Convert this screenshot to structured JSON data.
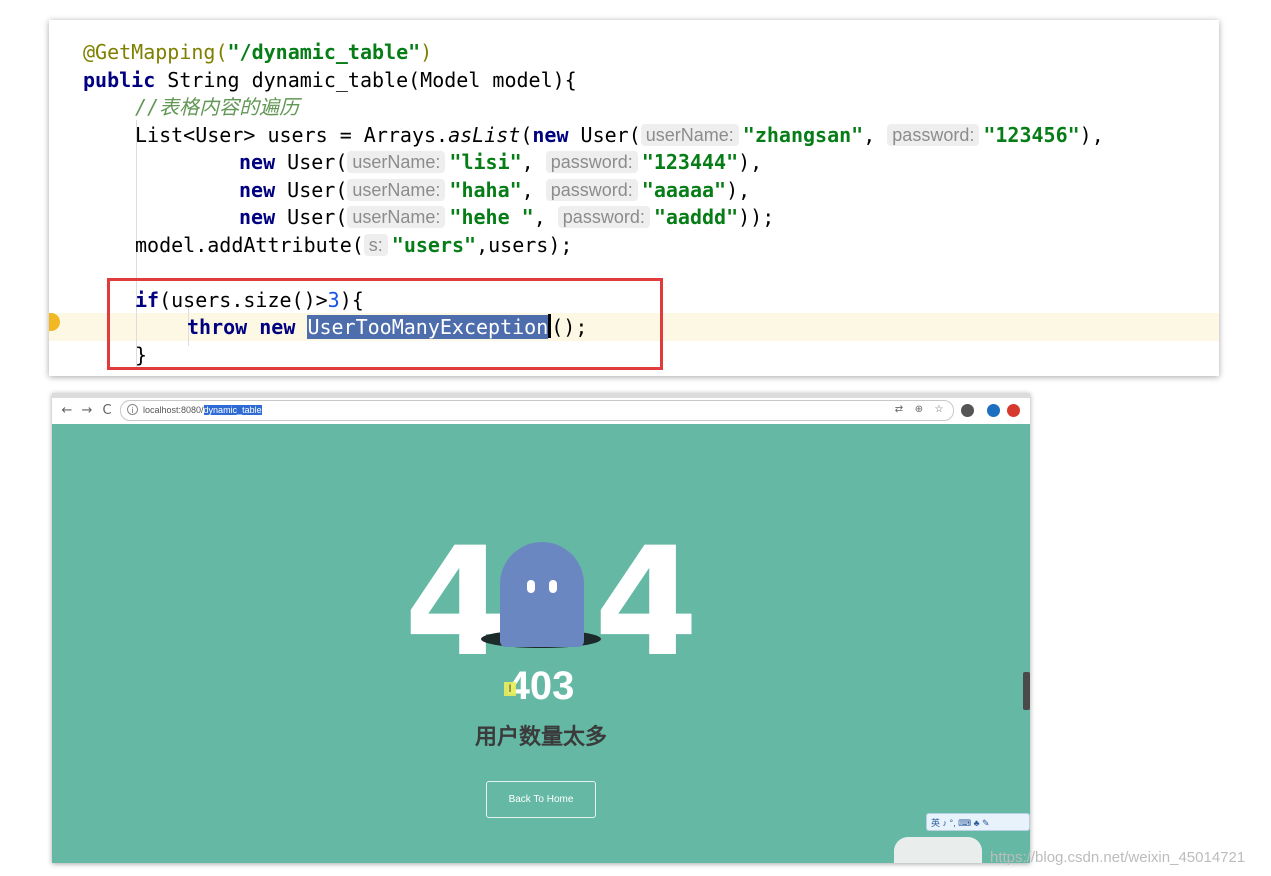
{
  "editor": {
    "line1": {
      "annotation": "@GetMapping(",
      "path": "\"/dynamic_table\"",
      "close": ")"
    },
    "line2": {
      "kw": "public",
      "rest": " String dynamic_table(Model model){"
    },
    "line3": {
      "comment": "//表格内容的遍历"
    },
    "line4": {
      "a": "List<User> users = Arrays.",
      "method": "asList",
      "b": "(",
      "kw": "new",
      "c": " User(",
      "hint1": "userName:",
      "s1": "\"zhangsan\"",
      "sep": ", ",
      "hint2": "password:",
      "s2": "\"123456\"",
      "end": "),"
    },
    "line5": {
      "kw": "new",
      "c": " User(",
      "hint1": "userName:",
      "s1": "\"lisi\"",
      "sep": ", ",
      "hint2": "password:",
      "s2": "\"123444\"",
      "end": "),"
    },
    "line6": {
      "kw": "new",
      "c": " User(",
      "hint1": "userName:",
      "s1": "\"haha\"",
      "sep": ", ",
      "hint2": "password:",
      "s2": "\"aaaaa\"",
      "end": "),"
    },
    "line7": {
      "kw": "new",
      "c": " User(",
      "hint1": "userName:",
      "s1": "\"hehe \"",
      "sep": ", ",
      "hint2": "password:",
      "s2": "\"aaddd\"",
      "end": "));"
    },
    "line8": {
      "a": "model.addAttribute(",
      "hint": "s:",
      "s": "\"users\"",
      "end": ",users);"
    },
    "line10": {
      "kw": "if",
      "a": "(users.size()>",
      "num": "3",
      "end": "){"
    },
    "line11": {
      "kw1": "throw",
      "kw2": "new",
      "selected": "UserTooManyException",
      "end": "();"
    },
    "line12": {
      "text": "}"
    }
  },
  "browser": {
    "back_glyph": "←",
    "forward_glyph": "→",
    "reload_glyph": "C",
    "info_glyph": "i",
    "url_host": "localhost:8080/",
    "url_path": "dynamic_table",
    "translate_glyph": "⇄",
    "zoom_glyph": "⊕",
    "star_glyph": "☆",
    "ext_colors": [
      "#555555",
      "#1d6fbf",
      "#d63a2f"
    ]
  },
  "page": {
    "four_left": "4",
    "four_right": "4",
    "code": "403",
    "message": "用户数量太多",
    "button": "Back To Home",
    "cursor_glyph": "I",
    "ime_text": "英 ♪ °, ⌨ ♣ ✎",
    "bg_color": "#64b8a4",
    "ghost_color": "#6b87c2"
  },
  "watermark": "https://blog.csdn.net/weixin_45014721"
}
